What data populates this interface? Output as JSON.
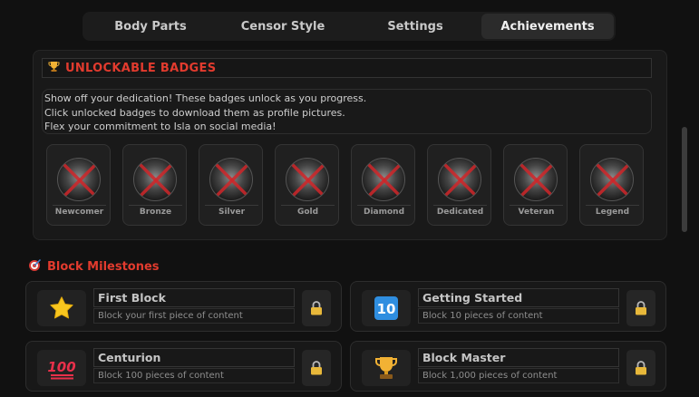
{
  "tabs": [
    {
      "label": "Body Parts",
      "active": false
    },
    {
      "label": "Censor Style",
      "active": false
    },
    {
      "label": "Settings",
      "active": false
    },
    {
      "label": "Achievements",
      "active": true
    }
  ],
  "badges_panel": {
    "title": "UNLOCKABLE BADGES",
    "icon": "trophy-icon",
    "description": [
      "Show off your dedication! These badges unlock as you progress.",
      "Click unlocked badges to download them as profile pictures.",
      "Flex your commitment to Isla on social media!"
    ],
    "badges": [
      {
        "label": "Newcomer",
        "locked": true
      },
      {
        "label": "Bronze",
        "locked": true
      },
      {
        "label": "Silver",
        "locked": true
      },
      {
        "label": "Gold",
        "locked": true
      },
      {
        "label": "Diamond",
        "locked": true
      },
      {
        "label": "Dedicated",
        "locked": true
      },
      {
        "label": "Veteran",
        "locked": true
      },
      {
        "label": "Legend",
        "locked": true
      }
    ]
  },
  "milestones": {
    "title": "Block Milestones",
    "icon": "target-icon",
    "items": [
      {
        "name": "First Block",
        "description": "Block your first piece of content",
        "icon": "star-icon",
        "locked": true
      },
      {
        "name": "Getting Started",
        "description": "Block 10 pieces of content",
        "icon": "keycap-ten-icon",
        "icon_text": "10",
        "locked": true
      },
      {
        "name": "Centurion",
        "description": "Block 100 pieces of content",
        "icon": "hundred-points-icon",
        "icon_text": "100",
        "locked": true
      },
      {
        "name": "Block Master",
        "description": "Block 1,000 pieces of content",
        "icon": "trophy-icon",
        "locked": true
      }
    ]
  },
  "colors": {
    "accent_red": "#e23b2e",
    "background": "#111111",
    "panel": "#191919",
    "lock_gold": "#e8b83a"
  }
}
